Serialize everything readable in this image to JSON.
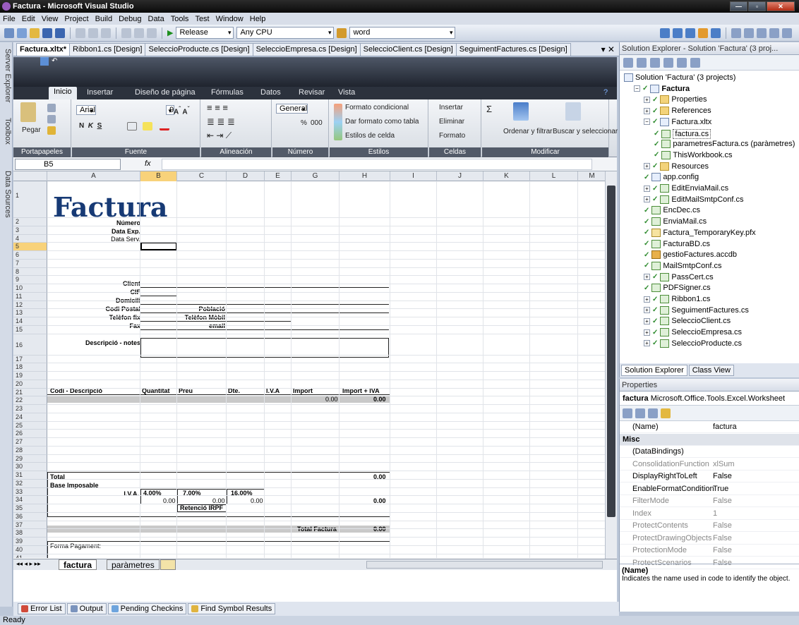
{
  "window": {
    "title": "Factura - Microsoft Visual Studio"
  },
  "menu": [
    "File",
    "Edit",
    "View",
    "Project",
    "Build",
    "Debug",
    "Data",
    "Tools",
    "Test",
    "Window",
    "Help"
  ],
  "toolbar": {
    "config": "Release",
    "platform": "Any CPU",
    "find": "word"
  },
  "left_strip": [
    "Server Explorer",
    "Toolbox",
    "Data Sources"
  ],
  "doc_tabs": [
    "Factura.xltx*",
    "Ribbon1.cs [Design]",
    "SeleccioProducte.cs [Design]",
    "SeleccioEmpresa.cs [Design]",
    "SeleccioClient.cs [Design]",
    "SeguimentFactures.cs [Design]"
  ],
  "ribbon": {
    "tabs": [
      "Inicio",
      "Insertar",
      "Diseño de página",
      "Fórmulas",
      "Datos",
      "Revisar",
      "Vista"
    ],
    "paste": "Pegar",
    "font": "Arial",
    "size": "9",
    "number_format": "General",
    "percent": "%",
    "thousands": "000",
    "cond_format": "Formato condicional",
    "table_format": "Dar formato como tabla",
    "cell_styles": "Estilos de celda",
    "insert": "Insertar",
    "delete": "Eliminar",
    "format": "Formato",
    "sort": "Ordenar y filtrar",
    "find": "Buscar y seleccionar",
    "groups": [
      "Portapapeles",
      "Fuente",
      "Alineación",
      "Número",
      "Estilos",
      "Celdas",
      "Modificar"
    ]
  },
  "formula_bar": {
    "cell": "B5",
    "fx": "fx"
  },
  "sheet": {
    "columns": [
      "A",
      "B",
      "C",
      "D",
      "E",
      "G",
      "H",
      "I",
      "J",
      "K",
      "L",
      "M"
    ],
    "rows": [
      "1",
      "2",
      "3",
      "4",
      "5",
      "6",
      "7",
      "8",
      "9",
      "10",
      "11",
      "12",
      "13",
      "14",
      "15",
      "16",
      "17",
      "18",
      "19",
      "20",
      "21",
      "22",
      "23",
      "24",
      "25",
      "26",
      "27",
      "28",
      "29",
      "30",
      "31",
      "32",
      "33",
      "34",
      "35",
      "36",
      "37",
      "38",
      "39",
      "40",
      "41",
      "42"
    ],
    "title": "Factura",
    "labels": {
      "numero": "Número",
      "data_exp": "Data Exp.",
      "data_serv": "Data Serv.",
      "client": "Client",
      "cif": "CIF",
      "domicili": "Domicili",
      "codi_postal": "Codi Postal",
      "poblacio": "Població",
      "telefon_fix": "Telèfon fix",
      "telefon_mobil": "Telèfon Mòbil",
      "fax": "Fax",
      "email": "email",
      "descripcio": "Descripció - notes"
    },
    "line_header": [
      "Codi - Descripció",
      "Quantitat",
      "Preu",
      "Dte.",
      "I.V.A",
      "Import",
      "Import + IVA"
    ],
    "line_values": {
      "import": "0.00",
      "import_iva": "0.00"
    },
    "totals": {
      "total": "Total",
      "base": "Base Imposable",
      "iva_label": "I.V.A.",
      "iva4": "4.00%",
      "iva7": "7.00%",
      "iva16": "16.00%",
      "z1": "0.00",
      "z2": "0.00",
      "z3": "0.00",
      "retencio": "Retenció IRPF",
      "total_factura": "Total Factura",
      "total_val": "0.00",
      "base_val": "0.00",
      "tf_val": "0.00",
      "forma": "Forma Pagament:"
    }
  },
  "sheet_tabs": [
    "factura",
    "paràmetres"
  ],
  "bottom_tabs": [
    "Error List",
    "Output",
    "Pending Checkins",
    "Find Symbol Results"
  ],
  "status": "Ready",
  "solution_explorer": {
    "title": "Solution Explorer - Solution 'Factura' (3 proj...",
    "items": [
      "Solution 'Factura' (3 projects)",
      "Factura",
      "Properties",
      "References",
      "Factura.xltx",
      "factura.cs",
      "parametresFactura.cs (paràmetres)",
      "ThisWorkbook.cs",
      "Resources",
      "app.config",
      "EditEnviaMail.cs",
      "EditMailSmtpConf.cs",
      "EncDec.cs",
      "EnviaMail.cs",
      "Factura_TemporaryKey.pfx",
      "FacturaBD.cs",
      "gestioFactures.accdb",
      "MailSmtpConf.cs",
      "PassCert.cs",
      "PDFSigner.cs",
      "Ribbon1.cs",
      "SeguimentFactures.cs",
      "SeleccioClient.cs",
      "SeleccioEmpresa.cs",
      "SeleccioProducte.cs"
    ],
    "tabs": [
      "Solution Explorer",
      "Class View"
    ]
  },
  "properties": {
    "title": "Properties",
    "object": "factura",
    "object_type": "Microsoft.Office.Tools.Excel.Worksheet",
    "rows": [
      [
        "(Name)",
        "factura"
      ],
      [
        "Misc",
        ""
      ],
      [
        "(DataBindings)",
        ""
      ],
      [
        "ConsolidationFunction",
        "xlSum"
      ],
      [
        "DisplayRightToLeft",
        "False"
      ],
      [
        "EnableFormatCondition",
        "True"
      ],
      [
        "FilterMode",
        "False"
      ],
      [
        "Index",
        "1"
      ],
      [
        "ProtectContents",
        "False"
      ],
      [
        "ProtectDrawingObjects",
        "False"
      ],
      [
        "ProtectionMode",
        "False"
      ],
      [
        "ProtectScenarios",
        "False"
      ]
    ],
    "desc_title": "(Name)",
    "desc": "Indicates the name used in code to identify the object."
  }
}
